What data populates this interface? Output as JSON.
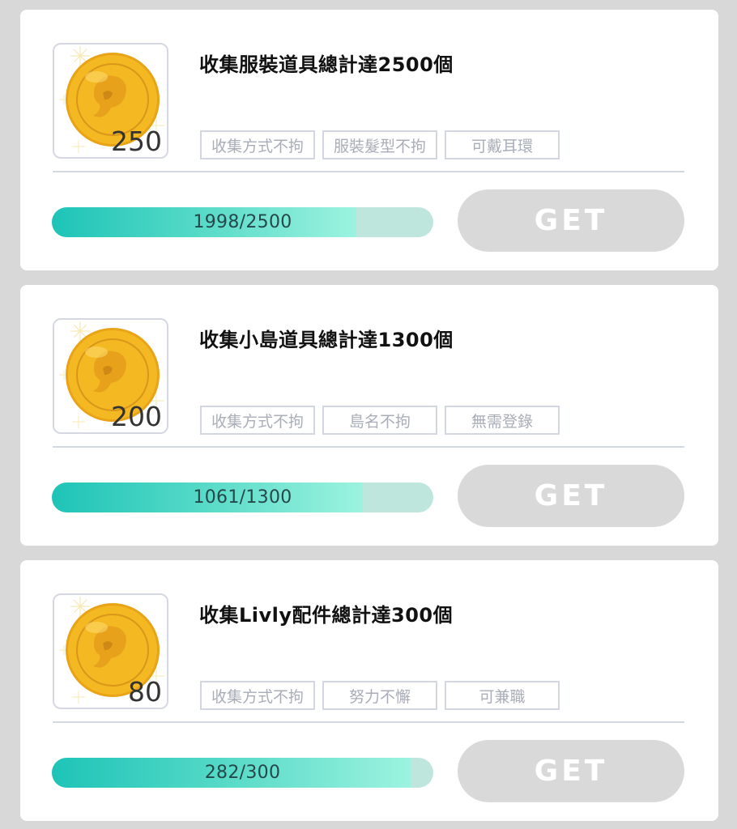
{
  "quests": [
    {
      "reward": "250",
      "title": "收集服裝道具總計達2500個",
      "tags": [
        "收集方式不拘",
        "服裝髮型不拘",
        "可戴耳環"
      ],
      "progress_text": "1998/2500",
      "progress": 0.7992,
      "button_label": "GET",
      "coin_icon": "gold-coin-icon"
    },
    {
      "reward": "200",
      "title": "收集小島道具總計達1300個",
      "tags": [
        "收集方式不拘",
        "島名不拘",
        "無需登錄"
      ],
      "progress_text": "1061/1300",
      "progress": 0.8162,
      "button_label": "GET",
      "coin_icon": "gold-coin-icon"
    },
    {
      "reward": "80",
      "title": "收集Livly配件總計達300個",
      "tags": [
        "收集方式不拘",
        "努力不懈",
        "可兼職"
      ],
      "progress_text": "282/300",
      "progress": 0.94,
      "button_label": "GET",
      "coin_icon": "gold-coin-icon"
    }
  ],
  "colors": {
    "background": "#d8d8d8",
    "progress_start": "#1ec4b8",
    "progress_end": "#9cf3df",
    "progress_track": "#bfe6dd",
    "button_disabled": "#d9d9d9",
    "coin_gold": "#f2b51e"
  }
}
